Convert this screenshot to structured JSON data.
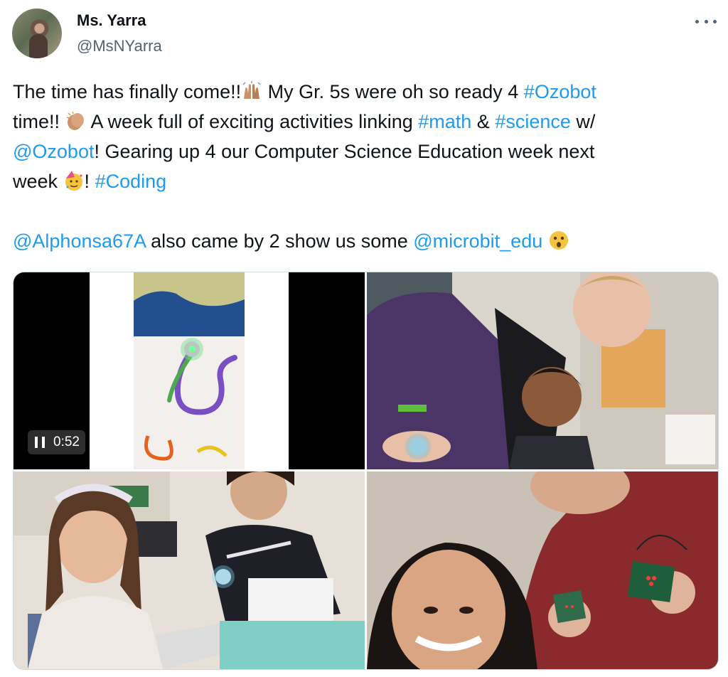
{
  "author": {
    "name": "Ms. Yarra",
    "handle": "@MsNYarra"
  },
  "tweet": {
    "line1_a": "The time has finally come!!",
    "line1_b": " My Gr. 5s were oh so ready 4 ",
    "tag_ozobot": "#Ozobot",
    "line2_a": "time!! ",
    "line2_b": " A week full of exciting activities linking ",
    "tag_math": "#math",
    "amp": " & ",
    "tag_science": "#science",
    "line2_c": " w/",
    "mention_ozobot": "@Ozobot",
    "line3_a": "! Gearing up 4 our Computer Science Education week next",
    "line4_a": "week ",
    "line4_b": "! ",
    "tag_coding": "#Coding",
    "mention_alphonsa": "@Alphonsa67A",
    "line6_a": " also came by 2 show us some ",
    "mention_microbit": "@microbit_edu",
    "emojis": [
      "raised-hands-emoji",
      "clapping-hands-emoji",
      "party-face-emoji",
      "astonished-face-emoji"
    ]
  },
  "media": {
    "video_time": "0:52",
    "photos": [
      "ozobot-video-thumbnail",
      "two-students-with-ozobot-photo",
      "students-at-desk-photo",
      "teachers-with-microbit-photo"
    ]
  },
  "colors": {
    "link": "#1d9bf0",
    "text": "#0f1419",
    "secondary": "#536471"
  }
}
